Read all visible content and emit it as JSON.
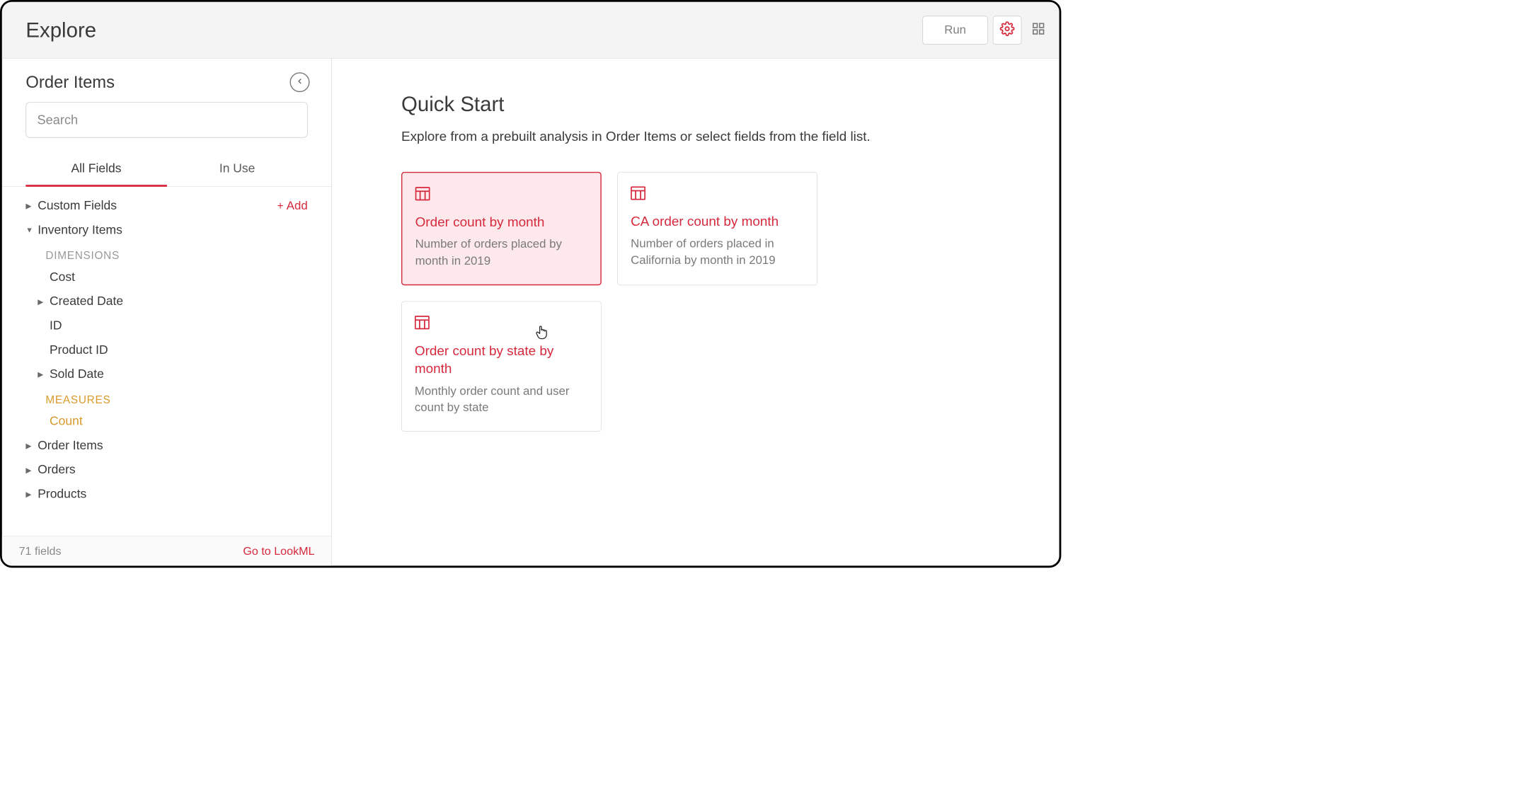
{
  "header": {
    "title": "Explore",
    "run_label": "Run"
  },
  "sidebar": {
    "title": "Order Items",
    "search_placeholder": "Search",
    "tabs": {
      "all_fields": "All Fields",
      "in_use": "In Use"
    },
    "add_label": "Add",
    "groups": {
      "custom_fields": "Custom Fields",
      "inventory_items": "Inventory Items",
      "order_items": "Order Items",
      "orders": "Orders",
      "products": "Products"
    },
    "dimensions_label": "DIMENSIONS",
    "measures_label": "MEASURES",
    "fields": {
      "cost": "Cost",
      "created_date": "Created Date",
      "id": "ID",
      "product_id": "Product ID",
      "sold_date": "Sold Date",
      "count": "Count"
    },
    "footer": {
      "fields_count": "71 fields",
      "lookml": "Go to LookML"
    }
  },
  "main": {
    "title": "Quick Start",
    "subtitle": "Explore from a prebuilt analysis in Order Items or select fields from the field list.",
    "cards": [
      {
        "title": "Order count by month",
        "desc": "Number of orders placed by month in 2019"
      },
      {
        "title": "CA order count by month",
        "desc": "Number of orders placed in California by month in 2019"
      },
      {
        "title": "Order count by state by month",
        "desc": "Monthly order count and user count by state"
      }
    ]
  }
}
